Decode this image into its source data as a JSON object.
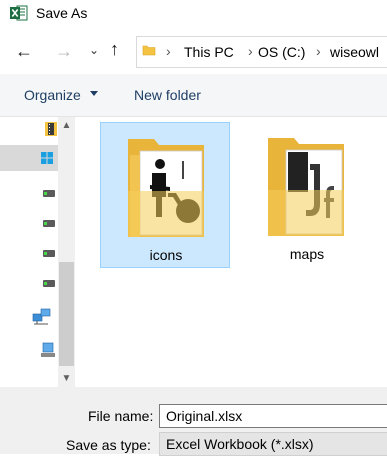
{
  "window": {
    "title": "Save As",
    "app_icon": "excel-icon"
  },
  "nav": {
    "back_icon": "arrow-left-icon",
    "forward_icon": "arrow-right-icon",
    "recent_icon": "chevron-down-icon",
    "up_icon": "arrow-up-icon",
    "breadcrumbs": [
      "This PC",
      "OS (C:)",
      "wiseowl"
    ]
  },
  "toolbar": {
    "organize_label": "Organize",
    "new_folder_label": "New folder"
  },
  "sidebar": {
    "items": [
      {
        "icon": "film-folder-icon"
      },
      {
        "icon": "windows-drive-icon",
        "selected": true
      },
      {
        "icon": "drive-icon"
      },
      {
        "icon": "drive-icon"
      },
      {
        "icon": "drive-icon"
      },
      {
        "icon": "drive-icon"
      },
      {
        "icon": "network-icon"
      },
      {
        "icon": "homegroup-icon"
      }
    ]
  },
  "folders": [
    {
      "name": "icons",
      "selected": true
    },
    {
      "name": "maps",
      "selected": false
    }
  ],
  "fields": {
    "file_name_label": "File name:",
    "file_name_value": "Original.xlsx",
    "save_type_label": "Save as type:",
    "save_type_value": "Excel Workbook (*.xlsx)"
  },
  "colors": {
    "excel_green": "#1d6f42",
    "folder_yellow": "#f5c342",
    "selection_fill": "#cce8ff",
    "selection_border": "#99d1ff",
    "link_blue": "#1e3e64"
  }
}
